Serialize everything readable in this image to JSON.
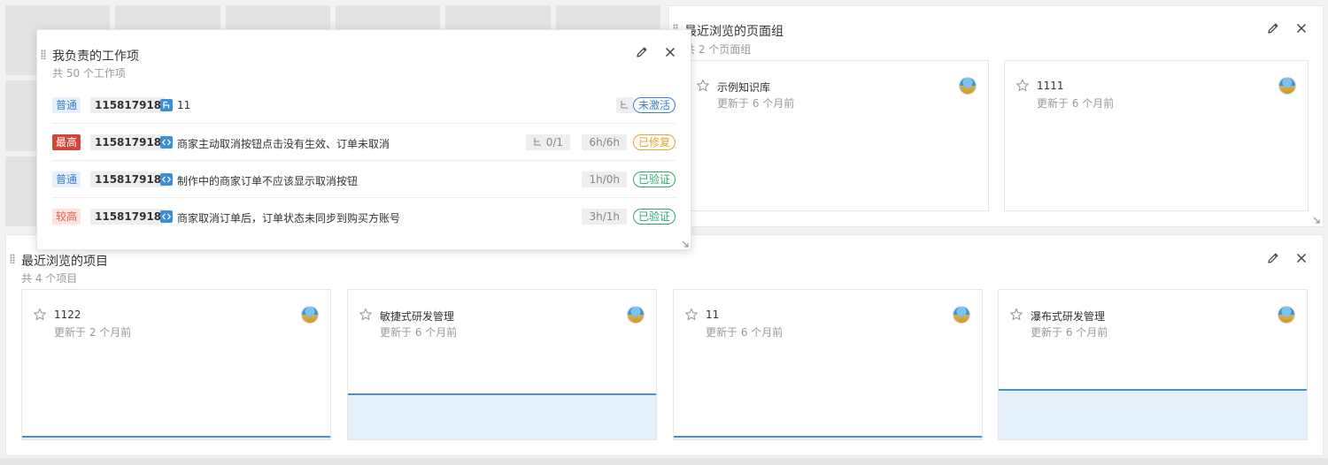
{
  "colors": {
    "accent": "#3c80cc",
    "priority_highest": "#d44536",
    "priority_high": "#e2624f",
    "state_fixed": "#e2a531",
    "state_verified": "#2fa56b"
  },
  "my_work_items": {
    "title": "我负责的工作项",
    "subtitle": "共 50 个工作项",
    "items": [
      {
        "priority": "普通",
        "id": "115817918",
        "type_icon": "story-icon",
        "title": "11",
        "subtask_count": "",
        "hours": "",
        "state": "未激活"
      },
      {
        "priority": "最高",
        "id": "115817918",
        "type_icon": "code-icon",
        "title": "商家主动取消按钮点击没有生效、订单未取消",
        "subtask_count": "0/1",
        "hours": "6h/6h",
        "state": "已修复"
      },
      {
        "priority": "普通",
        "id": "115817918",
        "type_icon": "code-icon",
        "title": "制作中的商家订单不应该显示取消按钮",
        "subtask_count": "",
        "hours": "1h/0h",
        "state": "已验证"
      },
      {
        "priority": "较高",
        "id": "115817918",
        "type_icon": "code-icon",
        "title": "商家取消订单后，订单状态未同步到购买方账号",
        "subtask_count": "",
        "hours": "3h/1h",
        "state": "已验证"
      }
    ]
  },
  "recent_page_groups": {
    "title": "最近浏览的页面组",
    "subtitle": "共 2 个页面组",
    "cards": [
      {
        "name": "示例知识库",
        "updated": "更新于 6 个月前"
      },
      {
        "name": "1111",
        "updated": "更新于 6 个月前"
      }
    ]
  },
  "recent_projects": {
    "title": "最近浏览的项目",
    "subtitle": "共 4 个项目",
    "cards": [
      {
        "name": "1122",
        "updated": "更新于 2 个月前",
        "progress_level": 0.02
      },
      {
        "name": "敏捷式研发管理",
        "updated": "更新于 6 个月前",
        "progress_level": 0.45
      },
      {
        "name": "11",
        "updated": "更新于 6 个月前",
        "progress_level": 0.02
      },
      {
        "name": "瀑布式研发管理",
        "updated": "更新于 6 个月前",
        "progress_level": 0.5
      }
    ]
  }
}
